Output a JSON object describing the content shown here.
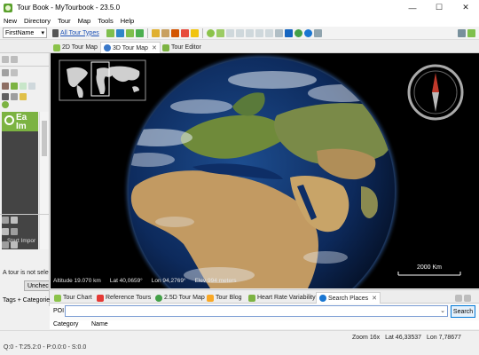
{
  "window": {
    "title": "Tour Book - MyTourbook - 23.5.0",
    "minimize_glyph": "—",
    "maximize_glyph": "☐",
    "close_glyph": "✕"
  },
  "menu": [
    "New",
    "Directory",
    "Tour",
    "Map",
    "Tools",
    "Help"
  ],
  "toolbar": {
    "person_select": "FirstName",
    "tour_type_filter": "All Tour Types"
  },
  "map_tabs": [
    {
      "label": "2D Tour Map",
      "icon": "map-2d-icon",
      "active": false
    },
    {
      "label": "3D Tour Map",
      "icon": "globe-icon",
      "active": true
    },
    {
      "label": "Tour Editor",
      "icon": "tour-editor-icon",
      "active": false
    }
  ],
  "left_panel": {
    "import_heading": "Ea\nIm",
    "import_start": "Start Impor",
    "tour_not_selected": "A tour is not sele",
    "uncheck_button": "Unchecl",
    "tags_label": "Tags + Categorie"
  },
  "map": {
    "altitude": "Altitude 19.070 km",
    "lat": "Lat 40,0659°",
    "lon": "Lon 94,2769°",
    "elev": "Elev 994 meters",
    "scale": "2000 Km",
    "colors": {
      "ocean": "#0d2a5c",
      "land": "#b89462",
      "background": "#000000"
    }
  },
  "bottom_tabs": [
    {
      "label": "Tour Chart",
      "icon": "tour-chart-icon",
      "active": false
    },
    {
      "label": "Reference Tours",
      "icon": "reference-tours-icon",
      "active": false
    },
    {
      "label": "2.5D Tour Map",
      "icon": "map-25d-icon",
      "active": false
    },
    {
      "label": "Tour Blog",
      "icon": "tour-blog-icon",
      "active": false
    },
    {
      "label": "Heart Rate Variability",
      "icon": "heart-icon",
      "active": false
    },
    {
      "label": "Search Places",
      "icon": "search-icon",
      "active": true
    }
  ],
  "search": {
    "poi_label": "POI",
    "poi_value": "",
    "search_button": "Search",
    "columns": [
      "Category",
      "Name"
    ]
  },
  "statusbar": {
    "left": "Q:0 - T:25.2:0 - P:0.0:0 - S:0.0",
    "zoom": "Zoom 16x",
    "lat": "Lat 46,33537",
    "lon": "Lon 7,78677"
  }
}
